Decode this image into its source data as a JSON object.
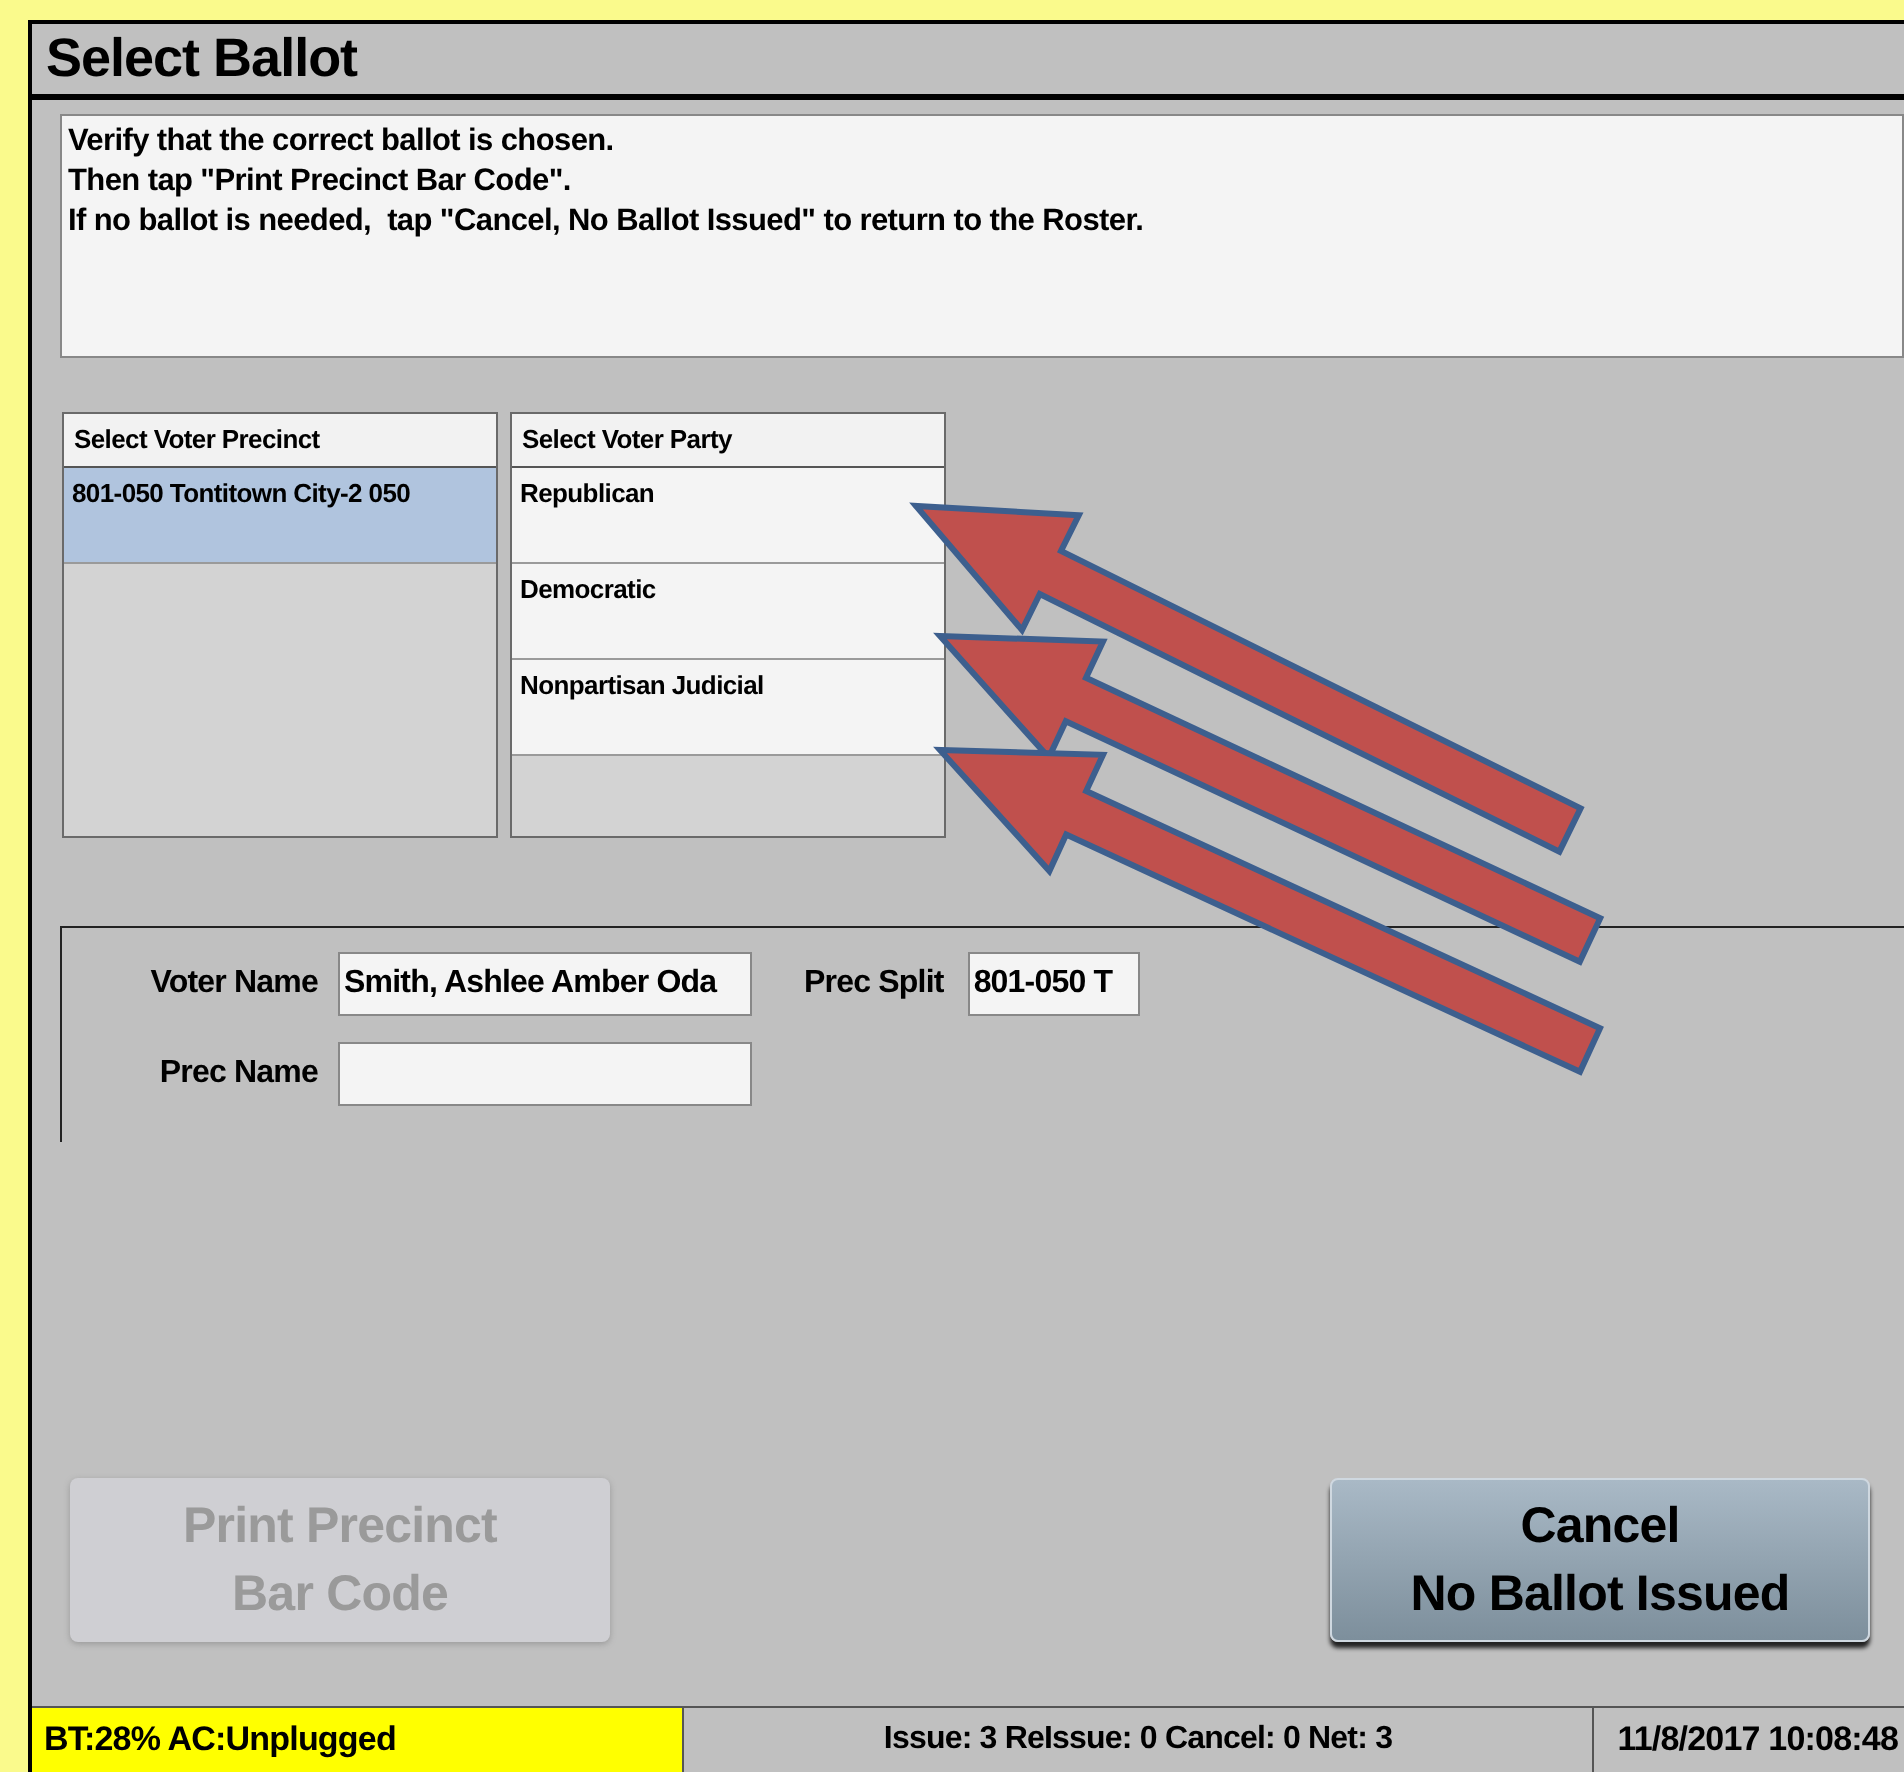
{
  "window": {
    "title": "Select Ballot"
  },
  "instructions": [
    "Verify that the correct ballot is chosen.",
    "Then tap \"Print Precinct Bar Code\".",
    "If no ballot is needed,  tap \"Cancel, No Ballot Issued\" to return to the Roster."
  ],
  "precinct_list": {
    "header": "Select Voter Precinct",
    "items": [
      {
        "label": "801-050 Tontitown City-2 050",
        "selected": true
      }
    ]
  },
  "party_list": {
    "header": "Select Voter Party",
    "items": [
      {
        "label": "Republican",
        "selected": false
      },
      {
        "label": "Democratic",
        "selected": false
      },
      {
        "label": "Nonpartisan Judicial",
        "selected": false
      }
    ]
  },
  "form": {
    "voter_name": {
      "label": "Voter Name",
      "value": "Smith, Ashlee Amber Oda"
    },
    "prec_split": {
      "label": "Prec Split",
      "value": "801-050 T"
    },
    "prec_name": {
      "label": "Prec Name"
    }
  },
  "buttons": [
    {
      "lines": [
        "Print Precinct",
        "Bar Code"
      ],
      "disabled": true
    },
    {
      "lines": [
        "Cancel",
        "No Ballot Issued"
      ],
      "disabled": false
    }
  ],
  "status_bar": {
    "power": "BT:28% AC:Unplugged",
    "counts": "Issue: 3 ReIssue: 0 Cancel: 0 Net: 3",
    "datetime": "11/8/2017 10:08:48"
  }
}
